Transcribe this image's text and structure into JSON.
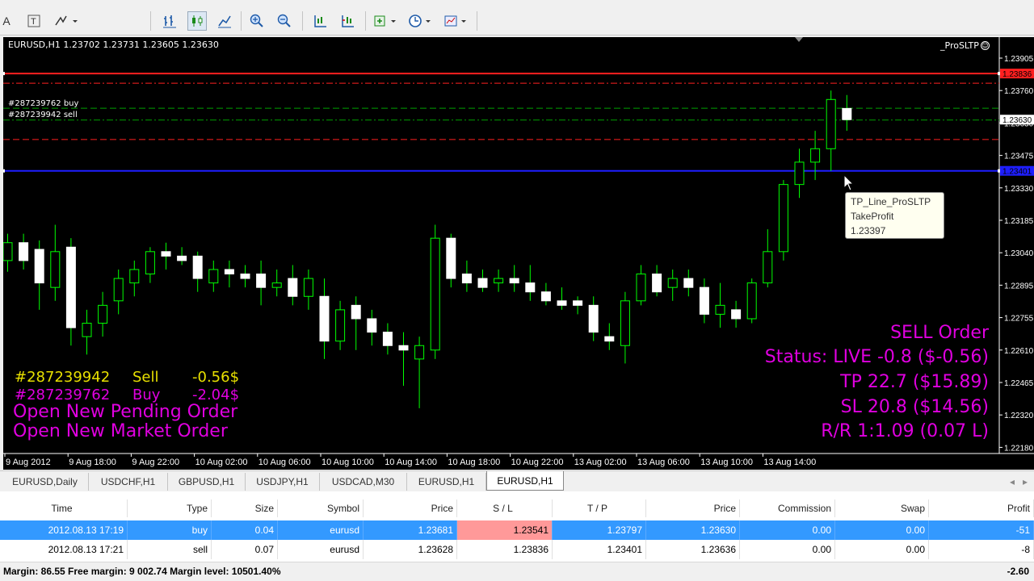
{
  "colors": {
    "bg": "#000000",
    "bull": "#ffffff",
    "wick": "#00ff00",
    "grid_green": "#00a000",
    "red_line": "#ff2020",
    "blue_line": "#1e1eff",
    "magenta": "#e000e0",
    "yellow": "#e8e000",
    "selection": "#3399ff",
    "sl_highlight": "#ff9999"
  },
  "toolbar": {
    "items": [
      "chart-type-icon",
      "text-icon",
      "arrows-icon",
      "bar-chart-icon",
      "candle-icon",
      "line-chart-icon",
      "zoom-in-icon",
      "zoom-out-icon",
      "shift-icon",
      "autoscroll-icon",
      "indicators-icon",
      "periods-icon",
      "templates-icon"
    ]
  },
  "chart": {
    "header": "EURUSD,H1  1.23702 1.23731 1.23605 1.23630",
    "ea_label": "_ProSLTP",
    "order_labels": [
      "#287239762 buy",
      "#287239942 sell"
    ],
    "tooltip": {
      "line1": "TP_Line_ProSLTP",
      "line2": "TakeProfit",
      "line3": "1.23397"
    },
    "price_labels": [
      "1.23905",
      "1.23760",
      "1.23630",
      "1.23475",
      "1.23330",
      "1.23185",
      "1.23040",
      "1.22895",
      "1.22755",
      "1.22610",
      "1.22465",
      "1.22320",
      "1.22180"
    ],
    "tag_red": "1.23836",
    "tag_current": "1.23630",
    "tag_blue": "1.23401",
    "time_labels": [
      "9 Aug 2012",
      "9 Aug 18:00",
      "9 Aug 22:00",
      "10 Aug 02:00",
      "10 Aug 06:00",
      "10 Aug 10:00",
      "10 Aug 14:00",
      "10 Aug 18:00",
      "10 Aug 22:00",
      "13 Aug 02:00",
      "13 Aug 06:00",
      "13 Aug 10:00",
      "13 Aug 14:00"
    ],
    "left_info": [
      {
        "id": "#287239942",
        "type": "Sell",
        "pl": "-0.56$"
      },
      {
        "id": "#287239762",
        "type": "Buy",
        "pl": "-2.04$"
      }
    ],
    "open_pending": "Open New Pending Order",
    "open_market": "Open New Market Order",
    "right_info": {
      "title": "SELL Order",
      "status": "Status: LIVE -0.8 ($-0.56)",
      "tp": "TP  22.7 ($15.89)",
      "sl": "SL  20.8 ($14.56)",
      "rr": "R/R 1:1.09 (0.07 L)"
    }
  },
  "chart_tabs": [
    "EURUSD,Daily",
    "USDCHF,H1",
    "GBPUSD,H1",
    "USDJPY,H1",
    "USDCAD,M30",
    "EURUSD,H1",
    "EURUSD,H1"
  ],
  "terminal": {
    "headers": [
      "Time",
      "Type",
      "Size",
      "Symbol",
      "Price",
      "S / L",
      "T / P",
      "Price",
      "Commission",
      "Swap",
      "Profit"
    ],
    "rows": [
      [
        "2012.08.13 17:19",
        "buy",
        "0.04",
        "eurusd",
        "1.23681",
        "1.23541",
        "1.23797",
        "1.23630",
        "0.00",
        "0.00",
        "-51"
      ],
      [
        "2012.08.13 17:21",
        "sell",
        "0.07",
        "eurusd",
        "1.23628",
        "1.23836",
        "1.23401",
        "1.23636",
        "0.00",
        "0.00",
        "-8"
      ]
    ],
    "status": "Margin: 86.55  Free margin: 9 002.74  Margin level: 10501.40%",
    "total": "-2.60"
  }
}
